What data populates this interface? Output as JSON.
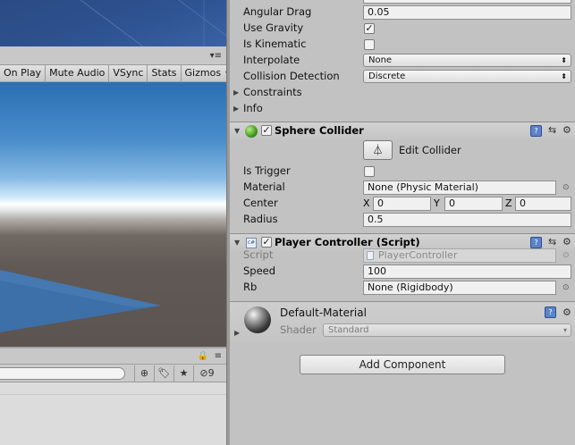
{
  "game_toolbar": {
    "items": [
      "On Play",
      "Mute Audio",
      "VSync",
      "Stats"
    ],
    "gizmos": "Gizmos"
  },
  "project_panel": {
    "tag_count": "9"
  },
  "inspector": {
    "rigidbody": {
      "angular_drag": {
        "label": "Angular Drag",
        "value": "0.05"
      },
      "use_gravity": {
        "label": "Use Gravity",
        "checked": true
      },
      "is_kinematic": {
        "label": "Is Kinematic",
        "checked": false
      },
      "interpolate": {
        "label": "Interpolate",
        "value": "None"
      },
      "collision_detection": {
        "label": "Collision Detection",
        "value": "Discrete"
      },
      "constraints": "Constraints",
      "info": "Info"
    },
    "sphere_collider": {
      "title": "Sphere Collider",
      "edit_collider": "Edit Collider",
      "is_trigger": {
        "label": "Is Trigger",
        "checked": false
      },
      "material": {
        "label": "Material",
        "value": "None (Physic Material)"
      },
      "center": {
        "label": "Center",
        "x_label": "X",
        "y_label": "Y",
        "z_label": "Z",
        "x": "0",
        "y": "0",
        "z": "0"
      },
      "radius": {
        "label": "Radius",
        "value": "0.5"
      }
    },
    "player_controller": {
      "title": "Player Controller (Script)",
      "script": {
        "label": "Script",
        "value": "PlayerController"
      },
      "speed": {
        "label": "Speed",
        "value": "100"
      },
      "rb": {
        "label": "Rb",
        "value": "None (Rigidbody)"
      }
    },
    "material": {
      "name": "Default-Material",
      "shader_label": "Shader",
      "shader_value": "Standard"
    },
    "add_component": "Add Component"
  },
  "colors": {
    "sky_top": "#2a6fb2",
    "ground": "#5b5450",
    "plane": "#3d6fa8",
    "scene_bg": "#2f5492",
    "panel_bg": "#c2c2c2"
  }
}
